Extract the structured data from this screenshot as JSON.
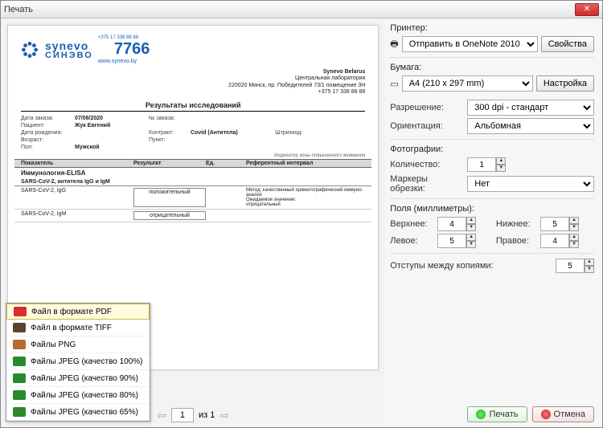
{
  "window": {
    "title": "Печать"
  },
  "printer": {
    "label": "Принтер:",
    "selected": "Отправить в OneNote 2010",
    "properties_btn": "Свойства"
  },
  "paper": {
    "label": "Бумага:",
    "selected": "A4 (210 x 297 mm)",
    "setup_btn": "Настройка"
  },
  "resolution": {
    "label": "Разрешение:",
    "value": "300 dpi - стандарт"
  },
  "orientation": {
    "label": "Ориентация:",
    "value": "Альбомная"
  },
  "photos": {
    "label": "Фотографии:",
    "count_label": "Количество:",
    "count": "1",
    "crop_label": "Маркеры обрезки:",
    "crop": "Нет"
  },
  "margins": {
    "label": "Поля (миллиметры):",
    "top_label": "Верхнее:",
    "top": "4",
    "bottom_label": "Нижнее:",
    "bottom": "5",
    "left_label": "Левое:",
    "left": "5",
    "right_label": "Правое:",
    "right": "4"
  },
  "spacing": {
    "label": "Отступы между копиями:",
    "value": "5"
  },
  "actions": {
    "print": "Печать",
    "cancel": "Отмена"
  },
  "pager": {
    "page": "1",
    "of_label": "из 1"
  },
  "export_menu": {
    "items": [
      {
        "label": "Файл в формате PDF",
        "color": "#d62f2f"
      },
      {
        "label": "Файл в формате TIFF",
        "color": "#5a442e"
      },
      {
        "label": "Файлы PNG",
        "color": "#b56d2f"
      },
      {
        "label": "Файлы JPEG (качество 100%)",
        "color": "#2a8a2a"
      },
      {
        "label": "Файлы JPEG (качество 90%)",
        "color": "#2a8a2a"
      },
      {
        "label": "Файлы JPEG (качество 80%)",
        "color": "#2a8a2a"
      },
      {
        "label": "Файлы JPEG (качество 65%)",
        "color": "#2a8a2a"
      }
    ]
  },
  "doc": {
    "brand1": "synevo",
    "brand2": "СИНЭВО",
    "phone_prefix": "+375 17 338 88 88",
    "phone": "7766",
    "url": "www.synevo.by",
    "addr1": "Synevo Belarus",
    "addr2": "Центральная лаборатория",
    "addr3": "220020 Минск, пр. Победителей 73/1 помещение 3Н",
    "addr4": "+375 17 338 88 88",
    "title": "Результаты исследований",
    "order_date_lbl": "Дата заказа:",
    "order_date": "07/08/2020",
    "order_no_lbl": "№ заказа:",
    "patient_lbl": "Пациент:",
    "patient": "Жук Евгений",
    "dob_lbl": "Дата рождения:",
    "contract_lbl": "Контракт:",
    "contract": "Covid (Антитела)",
    "barcode_lbl": "Штрихкод:",
    "age_lbl": "Возраст:",
    "point_lbl": "Пункт:",
    "sex_lbl": "Пол:",
    "sex": "Мужской",
    "indicator_note": "Индикатор зоны повышенного внимания",
    "col1": "Показатель",
    "col2": "Результат",
    "col3": "Ед.",
    "col4": "Референтный интервал",
    "section": "Иммунология-ELISA",
    "subsection": "SARS-CoV-2, антитела IgG и IgM",
    "row1_name": "SARS-CoV-2, IgG",
    "row1_result": "положительный",
    "row1_method": "Метод: качественный хроматографический иммуно-анализ\nОжидаемое значение:\nотрицательный",
    "row2_name": "SARS-CoV-2, IgM",
    "row2_result": "отрицательный"
  }
}
